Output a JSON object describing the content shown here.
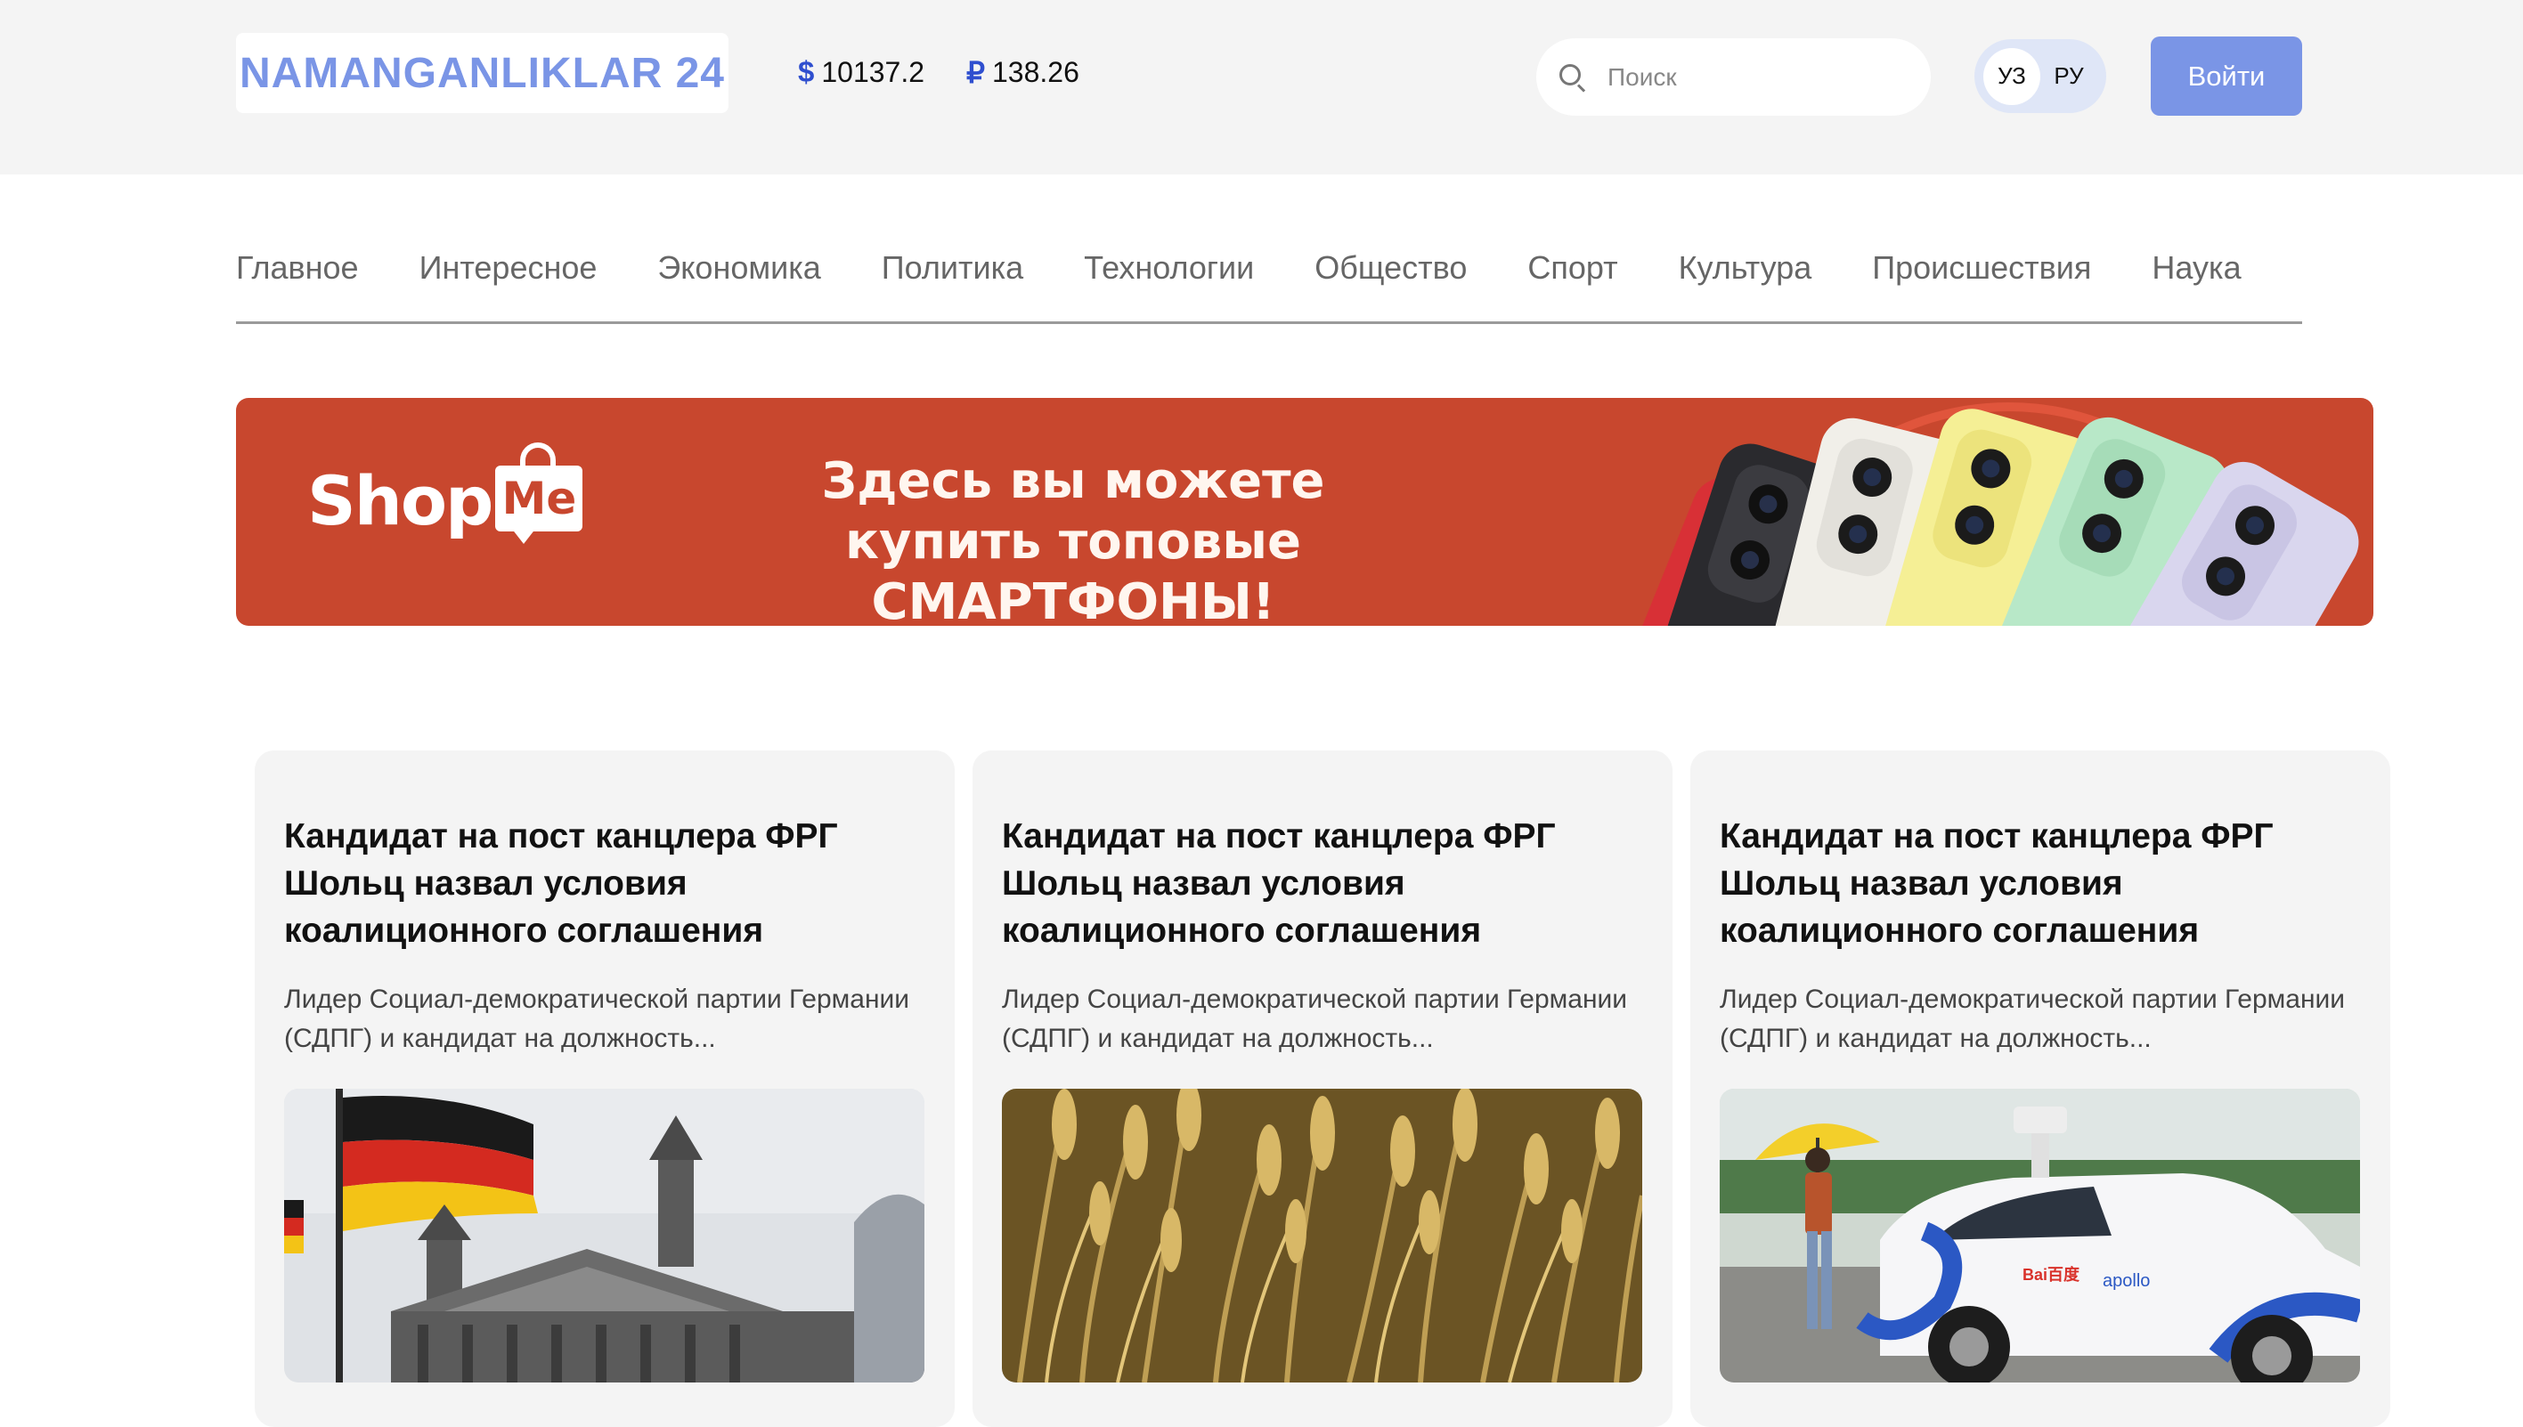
{
  "header": {
    "logo": "NAMANGANLIKLAR 24",
    "rates": [
      {
        "symbol": "$",
        "value": "10137.2"
      },
      {
        "symbol": "₽",
        "value": "138.26"
      }
    ],
    "search_placeholder": "Поиск",
    "lang": {
      "uz": "УЗ",
      "ru": "РУ"
    },
    "login_label": "Войти"
  },
  "nav": {
    "items": [
      "Главное",
      "Интересное",
      "Экономика",
      "Политика",
      "Технологии",
      "Общество",
      "Спорт",
      "Культура",
      "Происшествия",
      "Наука"
    ]
  },
  "banner": {
    "brand_shop": "Shop",
    "brand_me": "Me",
    "line1": "Здесь вы можете",
    "line2": "купить топовые СМАРТФОНЫ!"
  },
  "cards": [
    {
      "title": "Кандидат на пост канцлера ФРГ Шольц назвал условия коалиционного соглашения",
      "excerpt": "Лидер Социал-демократической партии Германии (СДПГ) и кандидат на должность...",
      "image": "reichstag-flag"
    },
    {
      "title": "Кандидат на пост канцлера ФРГ Шольц назвал условия коалиционного соглашения",
      "excerpt": "Лидер Социал-демократической партии Германии (СДПГ) и кандидат на должность...",
      "image": "wheat-field"
    },
    {
      "title": "Кандидат на пост канцлера ФРГ Шольц назвал условия коалиционного соглашения",
      "excerpt": "Лидер Социал-демократической партии Германии (СДПГ) и кандидат на должность...",
      "image": "robotaxi-woman-umbrella",
      "image_text": {
        "brand1": "Bai百度",
        "brand2": "apollo"
      }
    }
  ]
}
